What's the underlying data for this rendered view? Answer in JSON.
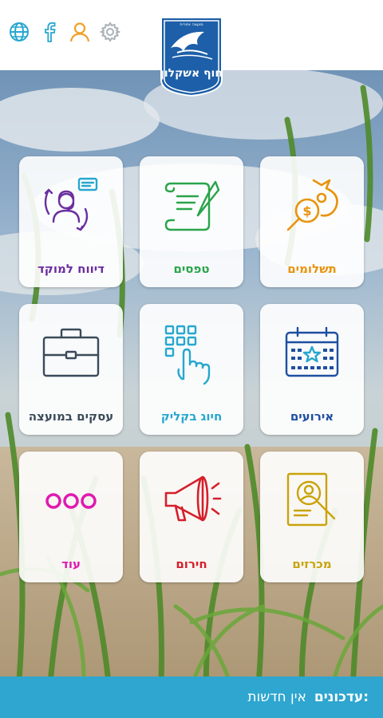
{
  "header": {
    "logo_top_text": "מועצה אזורית",
    "logo_text": "חוף אשקלון",
    "icons": [
      "globe-icon",
      "facebook-icon",
      "user-icon",
      "gear-icon"
    ]
  },
  "tiles": [
    {
      "label": "תשלומים",
      "icon": "payments-icon",
      "color": "#e8930c"
    },
    {
      "label": "טפסים",
      "icon": "forms-icon",
      "color": "#2aa44a"
    },
    {
      "label": "דיווח למוקד",
      "icon": "report-center-icon",
      "color": "#6a2ea0"
    },
    {
      "label": "אירועים",
      "icon": "calendar-icon",
      "color": "#1e4fa0"
    },
    {
      "label": "חיוג בקליק",
      "icon": "dial-icon",
      "color": "#27a7cf"
    },
    {
      "label": "עסקים במועצה",
      "icon": "briefcase-icon",
      "color": "#3a4a5a"
    },
    {
      "label": "מכרזים",
      "icon": "tenders-icon",
      "color": "#c9a30a"
    },
    {
      "label": "חירום",
      "icon": "megaphone-icon",
      "color": "#d61f2a"
    },
    {
      "label": "עוד",
      "icon": "more-icon",
      "color": "#e01ab0"
    }
  ],
  "news": {
    "title": "עדכונים:",
    "text": "אין חדשות"
  }
}
